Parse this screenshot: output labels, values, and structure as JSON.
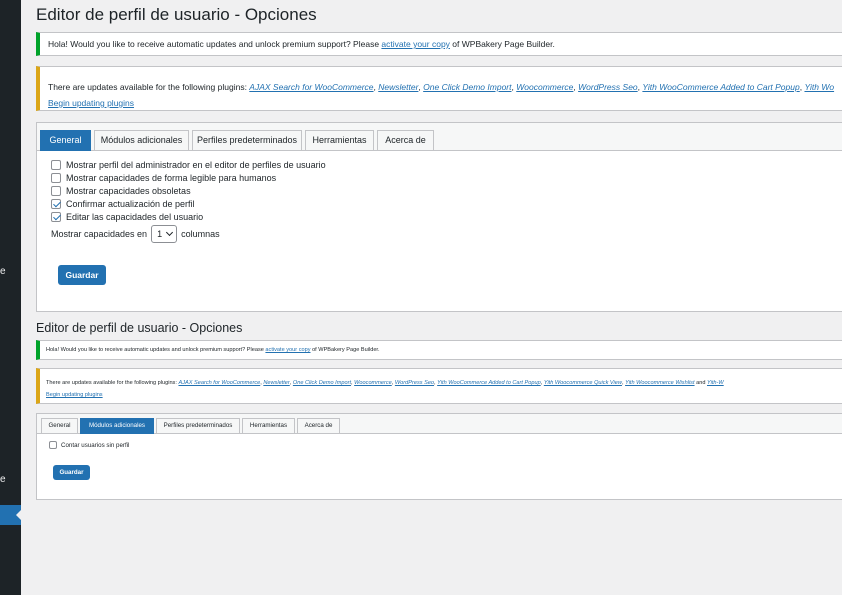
{
  "sidebar": {
    "fragment_1": "e",
    "fragment_2": "e"
  },
  "top": {
    "title": "Editor de perfil de usuario - Opciones",
    "notice_wpbakery": {
      "pre": "Hola! Would you like to receive automatic updates and unlock premium support? Please ",
      "link": "activate your copy",
      "post": " of WPBakery Page Builder."
    },
    "notice_updates": {
      "pre": "There are updates available for the following plugins: ",
      "plugins": [
        "AJAX Search for WooCommerce",
        "Newsletter",
        "One Click Demo Import",
        "Woocommerce",
        "WordPress Seo",
        "Yith WooCommerce Added to Cart Popup",
        "Yith Wo"
      ],
      "begin": "Begin updating plugins"
    },
    "tabs": [
      "General",
      "Módulos adicionales",
      "Perfiles predeterminados",
      "Herramientas",
      "Acerca de"
    ],
    "options": [
      {
        "label": "Mostrar perfil del administrador en el editor de perfiles de usuario",
        "checked": false
      },
      {
        "label": "Mostrar capacidades de forma legible para humanos",
        "checked": false
      },
      {
        "label": "Mostrar capacidades obsoletas",
        "checked": false
      },
      {
        "label": "Confirmar actualización de perfil",
        "checked": true
      },
      {
        "label": "Editar las capacidades del usuario",
        "checked": true
      }
    ],
    "columns": {
      "pre": "Mostrar capacidades en",
      "value": "1",
      "post": "columnas"
    },
    "save": "Guardar"
  },
  "bottom": {
    "title": "Editor de perfil de usuario - Opciones",
    "notice_wpbakery": {
      "pre": "Hola! Would you like to receive automatic updates and unlock premium support? Please ",
      "link": "activate your copy",
      "post": " of WPBakery Page Builder."
    },
    "notice_updates": {
      "pre": "There are updates available for the following plugins: ",
      "plugins": [
        "AJAX Search for WooCommerce",
        "Newsletter",
        "One Click Demo Import",
        "Woocommerce",
        "WordPress Seo",
        "Yith WooCommerce Added to Cart Popup",
        "Yith Woocommerce Quick View",
        "Yith Woocommerce Wishlist"
      ],
      "and": " and ",
      "last": "Yith-W",
      "begin": "Begin updating plugins"
    },
    "tabs": [
      "General",
      "Módulos adicionales",
      "Perfiles predeterminados",
      "Herramientas",
      "Acerca de"
    ],
    "option": {
      "label": "Contar usuarios sin perfil",
      "checked": false
    },
    "save": "Guardar"
  },
  "colors": {
    "accent": "#2271b1",
    "notice_success": "#00a32a",
    "notice_warning": "#dba617",
    "adminbar": "#1d2327"
  }
}
